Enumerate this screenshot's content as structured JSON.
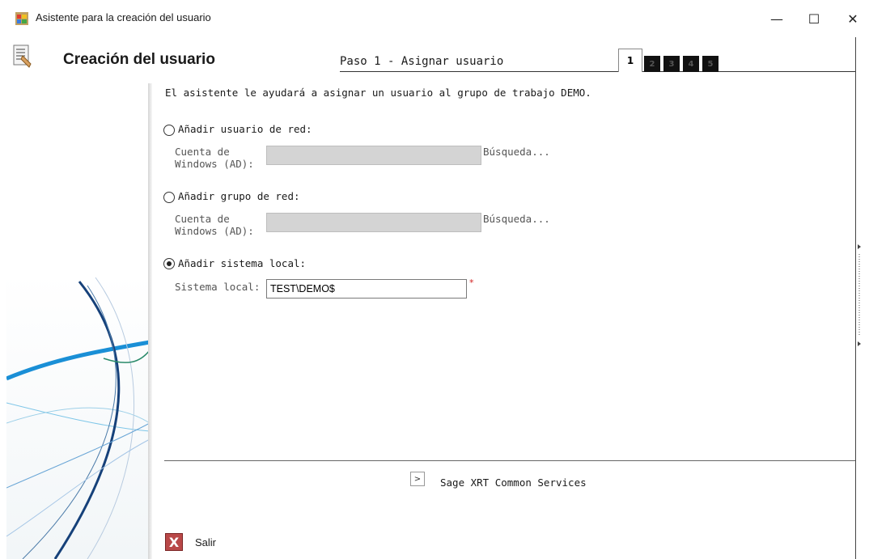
{
  "window": {
    "title": "Asistente para la creación del usuario",
    "minimize_glyph": "—",
    "maximize_glyph": "☐",
    "close_glyph": "✕"
  },
  "header": {
    "title": "Creación del usuario",
    "step_title": "Paso 1 - Asignar usuario",
    "steps": [
      "1",
      "2",
      "3",
      "4",
      "5"
    ],
    "active_step": "1"
  },
  "main": {
    "intro": "El asistente le ayudará a asignar un usuario al grupo de trabajo DEMO.",
    "options": [
      {
        "label": "Añadir usuario de red:",
        "checked": false,
        "field_label_line1": "Cuenta de",
        "field_label_line2": "Windows (AD):",
        "value": "",
        "search_label": "Búsqueda..."
      },
      {
        "label": "Añadir grupo de red:",
        "checked": false,
        "field_label_line1": "Cuenta de",
        "field_label_line2": "Windows (AD):",
        "value": "",
        "search_label": "Búsqueda..."
      },
      {
        "label": "Añadir sistema local:",
        "checked": true,
        "field_label": "Sistema local:",
        "value": "TEST\\DEMO$",
        "required_mark": "*"
      }
    ]
  },
  "footer": {
    "services_toggle_glyph": ">",
    "services_label": "Sage XRT Common Services",
    "exit_glyph": "X",
    "exit_label": "Salir"
  },
  "icons": {
    "app": "app-window-icon",
    "header": "wizard-checklist-icon",
    "exit": "exit-x-icon"
  },
  "colors": {
    "accent_blue": "#1a8fd6",
    "exit_red": "#b94848",
    "required_red": "#d22020"
  }
}
